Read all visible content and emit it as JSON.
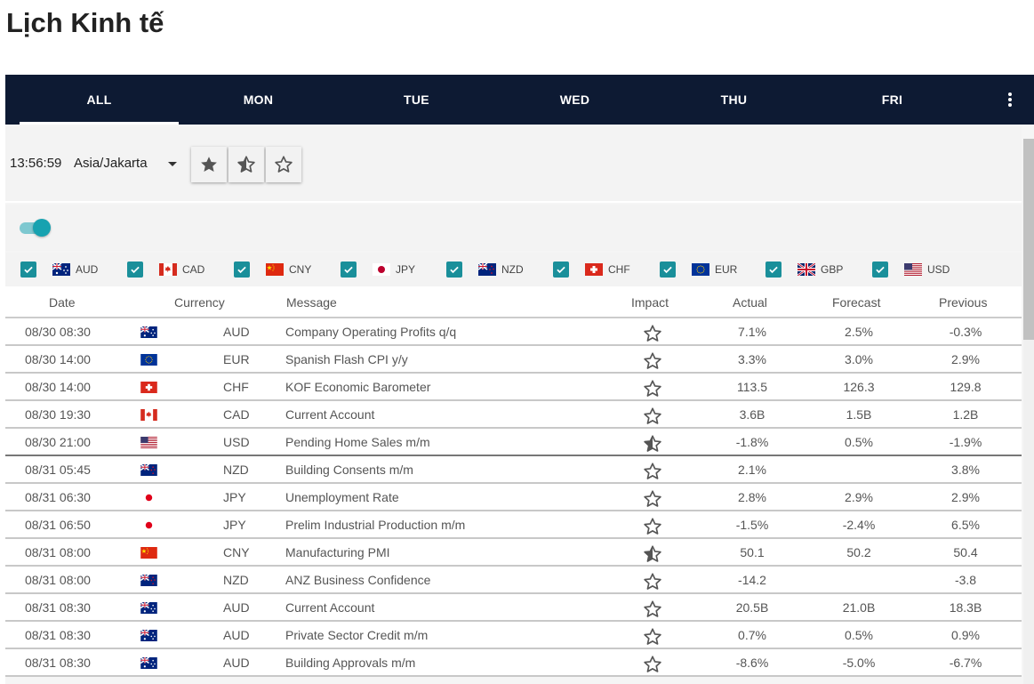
{
  "title": "Lịch Kinh tế",
  "tabs": [
    "ALL",
    "MON",
    "TUE",
    "WED",
    "THU",
    "FRI"
  ],
  "active_tab": "ALL",
  "clock": "13:56:59",
  "timezone": "Asia/Jakarta",
  "impact_buttons": [
    "impact-high",
    "impact-medium",
    "impact-low"
  ],
  "currency_filters": [
    {
      "code": "AUD",
      "checked": true
    },
    {
      "code": "CAD",
      "checked": true
    },
    {
      "code": "CNY",
      "checked": true
    },
    {
      "code": "JPY",
      "checked": true
    },
    {
      "code": "NZD",
      "checked": true
    },
    {
      "code": "CHF",
      "checked": true
    },
    {
      "code": "EUR",
      "checked": true
    },
    {
      "code": "GBP",
      "checked": true
    },
    {
      "code": "USD",
      "checked": true
    }
  ],
  "columns": {
    "date": "Date",
    "currency": "Currency",
    "message": "Message",
    "impact": "Impact",
    "actual": "Actual",
    "forecast": "Forecast",
    "previous": "Previous"
  },
  "rows": [
    {
      "date": "08/30 08:30",
      "currency": "AUD",
      "message": "Company Operating Profits q/q",
      "impact": "low",
      "actual": "7.1%",
      "forecast": "2.5%",
      "previous": "-0.3%"
    },
    {
      "date": "08/30 14:00",
      "currency": "EUR",
      "message": "Spanish Flash CPI y/y",
      "impact": "low",
      "actual": "3.3%",
      "forecast": "3.0%",
      "previous": "2.9%"
    },
    {
      "date": "08/30 14:00",
      "currency": "CHF",
      "message": "KOF Economic Barometer",
      "impact": "low",
      "actual": "113.5",
      "forecast": "126.3",
      "previous": "129.8"
    },
    {
      "date": "08/30 19:30",
      "currency": "CAD",
      "message": "Current Account",
      "impact": "low",
      "actual": "3.6B",
      "forecast": "1.5B",
      "previous": "1.2B"
    },
    {
      "date": "08/30 21:00",
      "currency": "USD",
      "message": "Pending Home Sales m/m",
      "impact": "medium",
      "actual": "-1.8%",
      "forecast": "0.5%",
      "previous": "-1.9%"
    },
    {
      "date": "08/31 05:45",
      "currency": "NZD",
      "message": "Building Consents m/m",
      "impact": "low",
      "actual": "2.1%",
      "forecast": "",
      "previous": "3.8%"
    },
    {
      "date": "08/31 06:30",
      "currency": "JPY",
      "message": "Unemployment Rate",
      "impact": "low",
      "actual": "2.8%",
      "forecast": "2.9%",
      "previous": "2.9%"
    },
    {
      "date": "08/31 06:50",
      "currency": "JPY",
      "message": "Prelim Industrial Production m/m",
      "impact": "low",
      "actual": "-1.5%",
      "forecast": "-2.4%",
      "previous": "6.5%"
    },
    {
      "date": "08/31 08:00",
      "currency": "CNY",
      "message": "Manufacturing PMI",
      "impact": "medium",
      "actual": "50.1",
      "forecast": "50.2",
      "previous": "50.4"
    },
    {
      "date": "08/31 08:00",
      "currency": "NZD",
      "message": "ANZ Business Confidence",
      "impact": "low",
      "actual": "-14.2",
      "forecast": "",
      "previous": "-3.8"
    },
    {
      "date": "08/31 08:30",
      "currency": "AUD",
      "message": "Current Account",
      "impact": "low",
      "actual": "20.5B",
      "forecast": "21.0B",
      "previous": "18.3B"
    },
    {
      "date": "08/31 08:30",
      "currency": "AUD",
      "message": "Private Sector Credit m/m",
      "impact": "low",
      "actual": "0.7%",
      "forecast": "0.5%",
      "previous": "0.9%"
    },
    {
      "date": "08/31 08:30",
      "currency": "AUD",
      "message": "Building Approvals m/m",
      "impact": "low",
      "actual": "-8.6%",
      "forecast": "-5.0%",
      "previous": "-6.7%"
    }
  ],
  "colors": {
    "tabbar": "#0d1a33",
    "accent": "#17a2b0",
    "checkbox": "#1a8f9a"
  }
}
